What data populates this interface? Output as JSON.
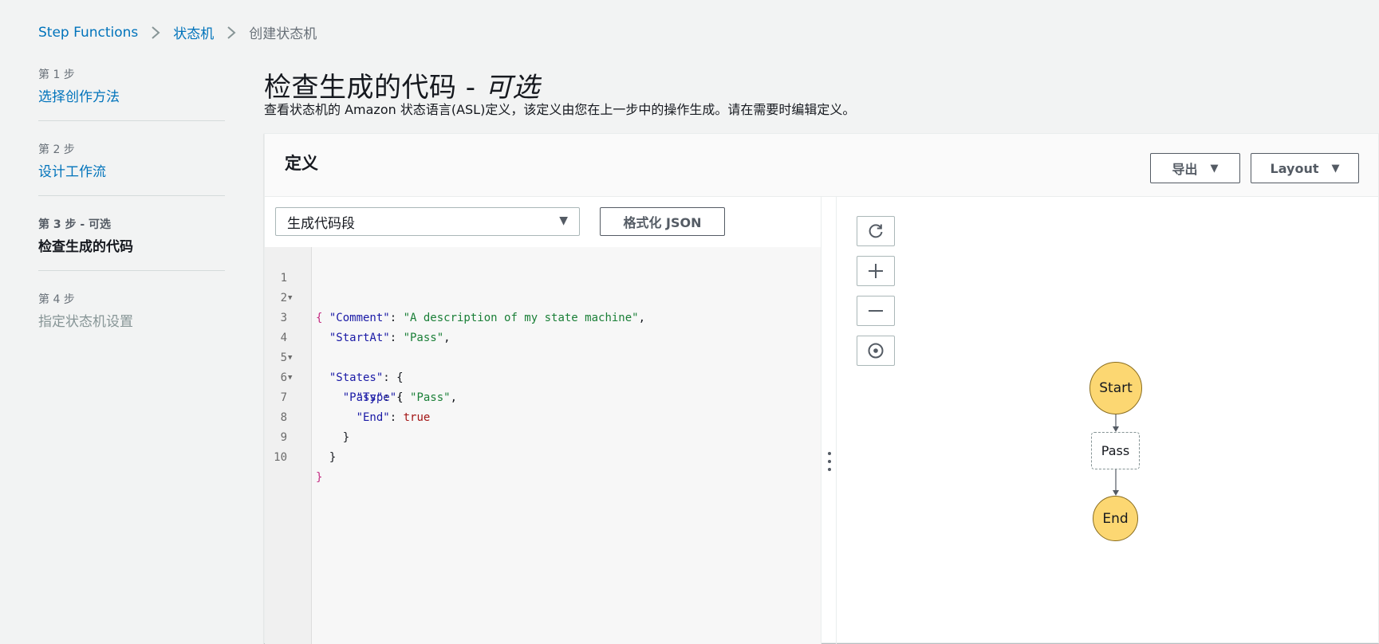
{
  "breadcrumb": {
    "items": [
      "Step Functions",
      "状态机",
      "创建状态机"
    ]
  },
  "steps": [
    {
      "num": "第 1 步",
      "title": "选择创作方法",
      "state": "link"
    },
    {
      "num": "第 2 步",
      "title": "设计工作流",
      "state": "link"
    },
    {
      "num": "第 3 步 - 可选",
      "title": "检查生成的代码",
      "state": "active"
    },
    {
      "num": "第 4 步",
      "title": "指定状态机设置",
      "state": "disabled"
    }
  ],
  "page": {
    "title": "检查生成的代码 - ",
    "title_optional": "可选",
    "description": "查看状态机的 Amazon 状态语言(ASL)定义，该定义由您在上一步中的操作生成。请在需要时编辑定义。"
  },
  "definition": {
    "title": "定义",
    "export_label": "导出",
    "layout_label": "Layout",
    "snippet_select_value": "生成代码段",
    "format_label": "格式化 JSON"
  },
  "code": {
    "line_numbers": [
      "1",
      "2",
      "3",
      "4",
      "5",
      "6",
      "7",
      "8",
      "9",
      "10"
    ],
    "lines": [
      "{",
      "  \"Comment\": \"A description of my state machine\",",
      "  \"StartAt\": \"Pass\",",
      "  \"States\": {",
      "    \"Pass\": {",
      "      \"Type\": \"Pass\",",
      "      \"End\": true",
      "    }",
      "  }",
      "}"
    ],
    "foldable_lines": [
      1,
      4,
      5
    ]
  },
  "graph": {
    "controls": [
      "refresh-icon",
      "zoom-in-icon",
      "zoom-out-icon",
      "center-icon"
    ],
    "nodes": {
      "start": "Start",
      "pass": "Pass",
      "end": "End"
    }
  },
  "colors": {
    "link": "#0073bb",
    "node_terminal": "#fcd772",
    "background": "#f2f3f3"
  }
}
